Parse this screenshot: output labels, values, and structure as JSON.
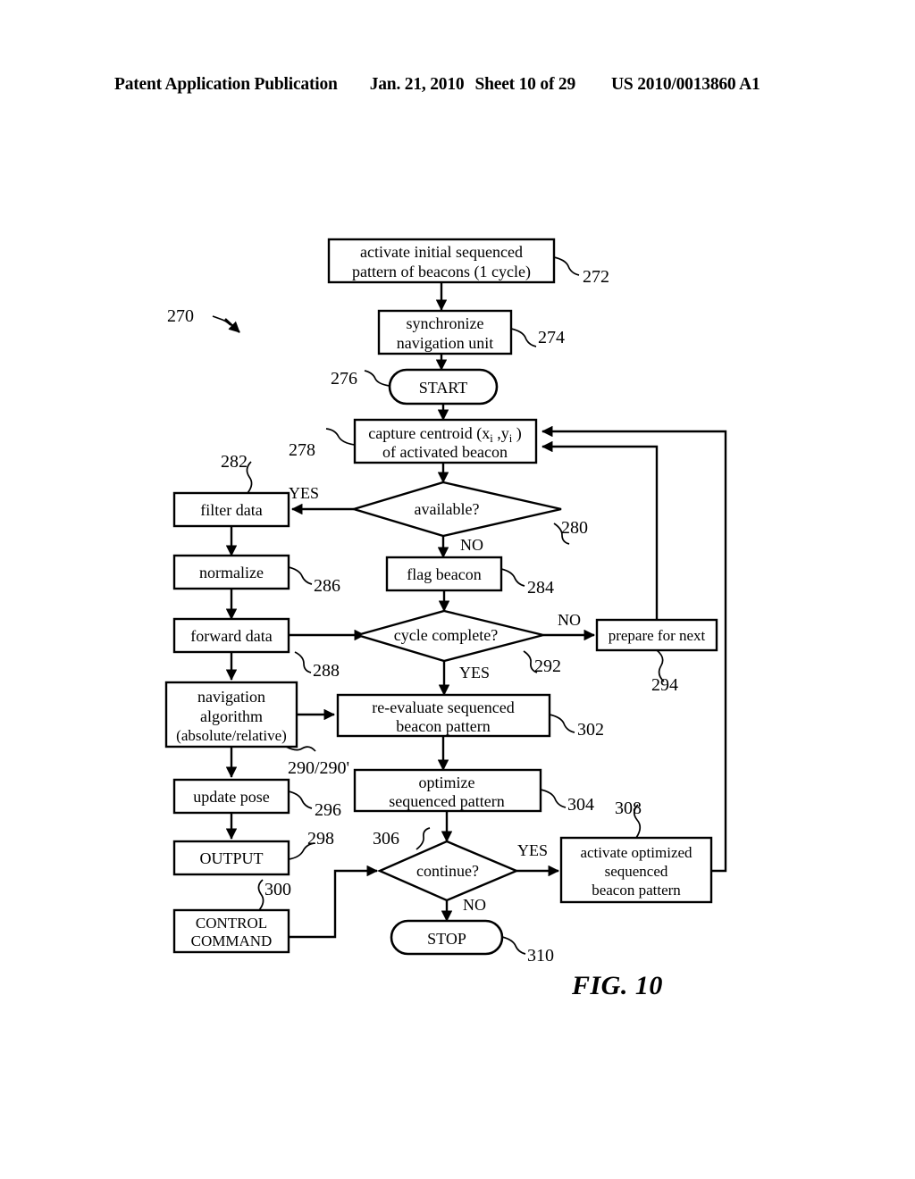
{
  "header": {
    "publication": "Patent Application Publication",
    "date": "Jan. 21, 2010",
    "sheet": "Sheet 10 of 29",
    "patent_number": "US 2010/0013860 A1"
  },
  "figure": {
    "label": "FIG. 10",
    "diagram_ref": "270"
  },
  "nodes": {
    "n272": {
      "ref": "272",
      "line1": "activate  initial sequenced",
      "line2": "pattern of  beacons (1 cycle)",
      "shape": "process"
    },
    "n274": {
      "ref": "274",
      "line1": "synchronize",
      "line2": "navigation unit",
      "shape": "process"
    },
    "n276": {
      "ref": "276",
      "line1": "START",
      "shape": "terminator"
    },
    "n278": {
      "ref": "278",
      "line1": "capture centroid (x",
      "sub1": "i",
      "mid1": " ,y",
      "sub2": "i",
      "tail1": " )",
      "line2": "of activated beacon",
      "shape": "process"
    },
    "n280": {
      "ref": "280",
      "line1": "available?",
      "shape": "decision"
    },
    "n282": {
      "ref": "282",
      "line1": "filter data",
      "shape": "process"
    },
    "n284": {
      "ref": "284",
      "line1": "flag beacon",
      "shape": "process"
    },
    "n286": {
      "ref": "286",
      "line1": "normalize",
      "shape": "process"
    },
    "n288": {
      "ref": "288",
      "line1": "forward data",
      "shape": "process"
    },
    "n290": {
      "ref": "290/290'",
      "line1": "navigation",
      "line2": "algorithm",
      "line3": "(absolute/relative)",
      "shape": "process"
    },
    "n292": {
      "ref": "292",
      "line1": "cycle complete?",
      "shape": "decision"
    },
    "n294": {
      "ref": "294",
      "line1": "prepare for next",
      "shape": "process"
    },
    "n296": {
      "ref": "296",
      "line1": "update pose",
      "shape": "process"
    },
    "n298": {
      "ref": "298",
      "line1": "OUTPUT",
      "shape": "process"
    },
    "n300": {
      "ref": "300",
      "line1": "CONTROL",
      "line2": "COMMAND",
      "shape": "process"
    },
    "n302": {
      "ref": "302",
      "line1": "re-evaluate sequenced",
      "line2": "beacon pattern",
      "shape": "process"
    },
    "n304": {
      "ref": "304",
      "line1": "optimize",
      "line2": "sequenced pattern",
      "shape": "process"
    },
    "n306": {
      "ref": "306",
      "line1": "continue?",
      "shape": "decision"
    },
    "n308": {
      "ref": "308",
      "line1": "activate optimized",
      "line2": "sequenced",
      "line3": "beacon pattern",
      "shape": "process"
    },
    "n310": {
      "ref": "310",
      "line1": "STOP",
      "shape": "terminator"
    }
  },
  "branch_labels": {
    "available_yes": "YES",
    "available_no": "NO",
    "cycle_no": "NO",
    "cycle_yes": "YES",
    "continue_yes": "YES",
    "continue_no": "NO"
  }
}
